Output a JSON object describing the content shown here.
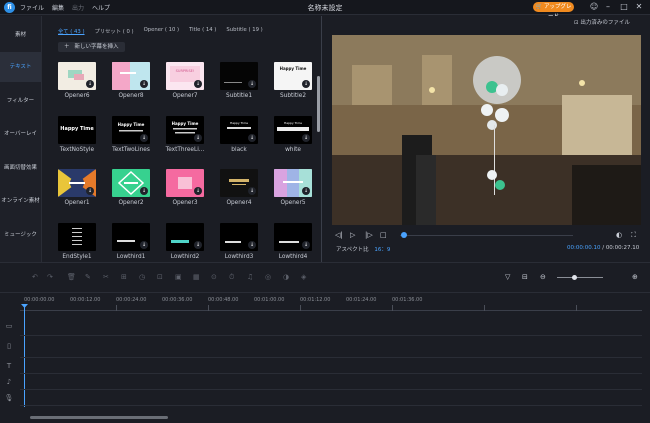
{
  "titlebar": {
    "logo": "fi",
    "menu": [
      "ファイル",
      "編集",
      "出力",
      "ヘルプ"
    ],
    "title": "名称未設定",
    "upgrade": "アップグレード"
  },
  "sidebar": {
    "items": [
      "素材",
      "テキスト",
      "フィルター",
      "オーバーレイ",
      "画面切替効果",
      "オンライン素材",
      "ミュージック"
    ]
  },
  "library": {
    "tabs": [
      "全て ( 43 )",
      "プリセット ( 0 )",
      "Opener ( 10 )",
      "Title ( 14 )",
      "Subtitle ( 19 )"
    ],
    "add_button": "新しい字幕を挿入",
    "tiles": [
      {
        "label": "Opener6",
        "bg": "#f2ede3",
        "caption": ""
      },
      {
        "label": "Opener8",
        "bg": "#f4a7c8",
        "caption": ""
      },
      {
        "label": "Opener7",
        "bg": "#fbe6f0",
        "caption": "SURPRISE!"
      },
      {
        "label": "Subtitle1",
        "bg": "#050505",
        "caption": ""
      },
      {
        "label": "Subtitle2",
        "bg": "#f5f5f5",
        "caption": "Happy Time"
      },
      {
        "label": "TextNoStyle",
        "bg": "#000000",
        "caption": "Happy Time"
      },
      {
        "label": "TextTwoLines",
        "bg": "#000000",
        "caption": "Happy Time"
      },
      {
        "label": "TextThreeLi...",
        "bg": "#000000",
        "caption": "Happy Time"
      },
      {
        "label": "black",
        "bg": "#000000",
        "caption": "Happy Time"
      },
      {
        "label": "white",
        "bg": "#000000",
        "caption": "Happy Time"
      },
      {
        "label": "Opener1",
        "bg": "#2a3a6a",
        "caption": ""
      },
      {
        "label": "Opener2",
        "bg": "#37d18f",
        "caption": ""
      },
      {
        "label": "Opener3",
        "bg": "#f56aa0",
        "caption": ""
      },
      {
        "label": "Opener4",
        "bg": "#111111",
        "caption": ""
      },
      {
        "label": "Opener5",
        "bg": "#9fb4e6",
        "caption": ""
      },
      {
        "label": "EndStyle1",
        "bg": "#000000",
        "caption": ""
      },
      {
        "label": "Lowthird1",
        "bg": "#000000",
        "caption": ""
      },
      {
        "label": "Lowthird2",
        "bg": "#000000",
        "caption": ""
      },
      {
        "label": "Lowthird3",
        "bg": "#000000",
        "caption": ""
      },
      {
        "label": "Lowthird4",
        "bg": "#000000",
        "caption": ""
      }
    ]
  },
  "preview": {
    "exported_link": "出力済みのファイル",
    "aspect_label": "アスペクト比",
    "aspect_value": "16：9",
    "time_current": "00:00:00.10",
    "time_separator": "/",
    "time_total": "00:00:27.10"
  },
  "timeline": {
    "ruler": [
      "00:00:00.00",
      "00:00:12.00",
      "00:00:24.00",
      "00:00:36.00",
      "00:00:48.00",
      "00:01:00.00",
      "00:01:12.00",
      "00:01:24.00",
      "00:01:36.00"
    ]
  },
  "colors": {
    "accent": "#4aa3ff",
    "upgrade": "#f08a1f",
    "background": "#1b1d24"
  }
}
